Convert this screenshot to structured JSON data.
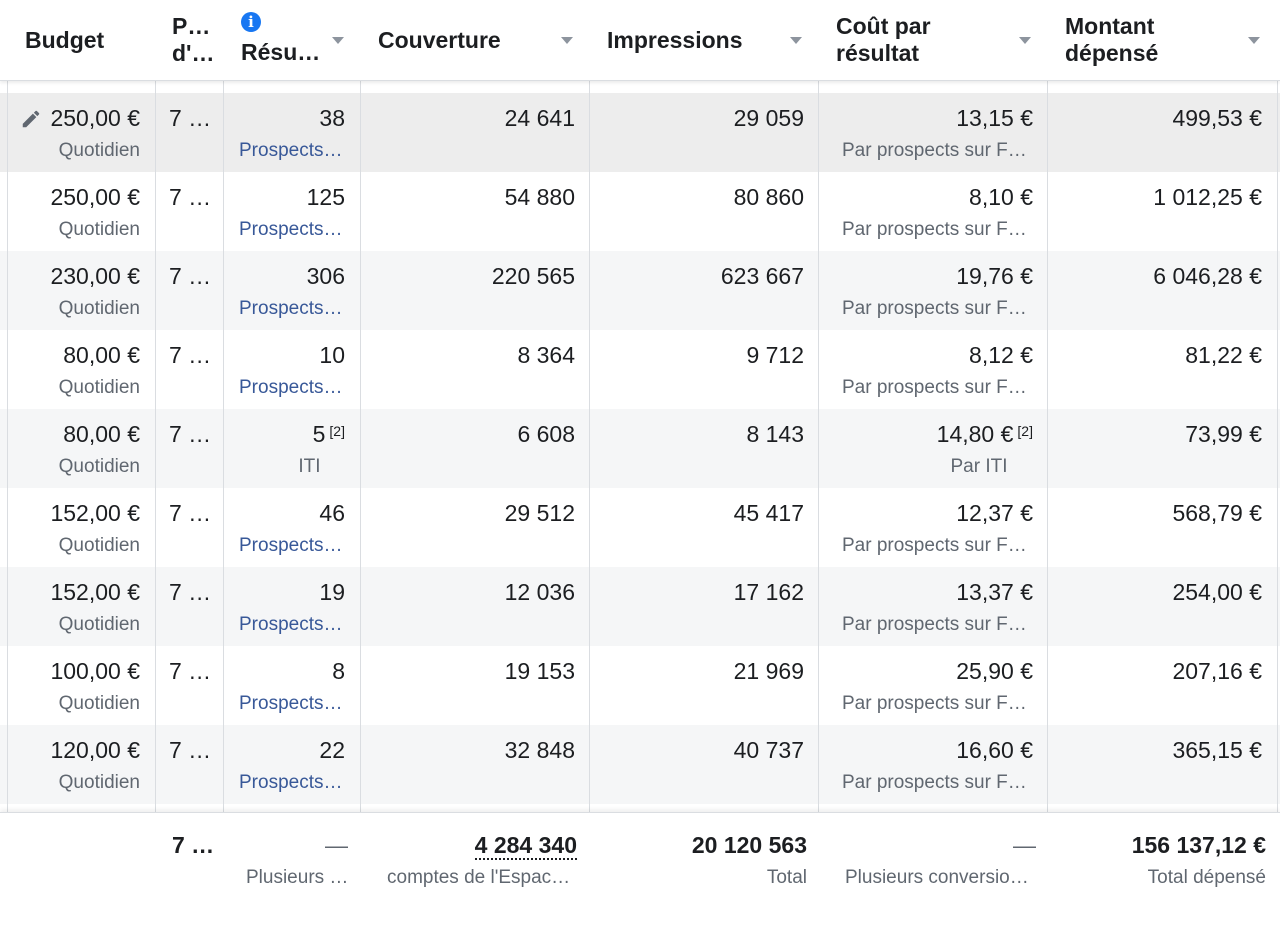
{
  "columns": {
    "budget": "Budget",
    "planning": "P… d'…",
    "results": "Résu…",
    "reach": "Couverture",
    "impressions": "Impressions",
    "cost_per_result": "Coût par résultat",
    "amount_spent": "Montant dépensé"
  },
  "rows": [
    {
      "budget": "250,00 €",
      "budget_type": "Quotidien",
      "planning": "7 …",
      "result": "38",
      "result_type": "Prospects…",
      "reach": "24 641",
      "impressions": "29 059",
      "cost": "13,15 €",
      "cost_type": "Par prospects sur F…",
      "spent": "499,53 €"
    },
    {
      "budget": "250,00 €",
      "budget_type": "Quotidien",
      "planning": "7 …",
      "result": "125",
      "result_type": "Prospects…",
      "reach": "54 880",
      "impressions": "80 860",
      "cost": "8,10 €",
      "cost_type": "Par prospects sur F…",
      "spent": "1 012,25 €"
    },
    {
      "budget": "230,00 €",
      "budget_type": "Quotidien",
      "planning": "7 …",
      "result": "306",
      "result_type": "Prospects…",
      "reach": "220 565",
      "impressions": "623 667",
      "cost": "19,76 €",
      "cost_type": "Par prospects sur F…",
      "spent": "6 046,28 €"
    },
    {
      "budget": "80,00 €",
      "budget_type": "Quotidien",
      "planning": "7 …",
      "result": "10",
      "result_type": "Prospects…",
      "reach": "8 364",
      "impressions": "9 712",
      "cost": "8,12 €",
      "cost_type": "Par prospects sur F…",
      "spent": "81,22 €"
    },
    {
      "budget": "80,00 €",
      "budget_type": "Quotidien",
      "planning": "7 …",
      "result": "5",
      "result_note": "[2]",
      "result_type": "ITI",
      "reach": "6 608",
      "impressions": "8 143",
      "cost": "14,80 €",
      "cost_note": "[2]",
      "cost_type": "Par ITI",
      "spent": "73,99 €"
    },
    {
      "budget": "152,00 €",
      "budget_type": "Quotidien",
      "planning": "7 …",
      "result": "46",
      "result_type": "Prospects…",
      "reach": "29 512",
      "impressions": "45 417",
      "cost": "12,37 €",
      "cost_type": "Par prospects sur F…",
      "spent": "568,79 €"
    },
    {
      "budget": "152,00 €",
      "budget_type": "Quotidien",
      "planning": "7 …",
      "result": "19",
      "result_type": "Prospects…",
      "reach": "12 036",
      "impressions": "17 162",
      "cost": "13,37 €",
      "cost_type": "Par prospects sur F…",
      "spent": "254,00 €"
    },
    {
      "budget": "100,00 €",
      "budget_type": "Quotidien",
      "planning": "7 …",
      "result": "8",
      "result_type": "Prospects…",
      "reach": "19 153",
      "impressions": "21 969",
      "cost": "25,90 €",
      "cost_type": "Par prospects sur F…",
      "spent": "207,16 €"
    },
    {
      "budget": "120,00 €",
      "budget_type": "Quotidien",
      "planning": "7 …",
      "result": "22",
      "result_type": "Prospects…",
      "reach": "32 848",
      "impressions": "40 737",
      "cost": "16,60 €",
      "cost_type": "Par prospects sur F…",
      "spent": "365,15 €"
    }
  ],
  "totals": {
    "planning": "7 …",
    "result": "—",
    "result_label": "Plusieurs …",
    "reach": "4 284 340",
    "reach_label": "comptes de l'Espac…",
    "impressions": "20 120 563",
    "impressions_label": "Total",
    "cost": "—",
    "cost_label": "Plusieurs conversio…",
    "spent": "156 137,12 €",
    "spent_label": "Total dépensé"
  },
  "colors": {
    "header_text": "#1c1e21",
    "secondary_text": "#606770",
    "link_text": "#385898",
    "info_icon": "#1877f2",
    "row_shade": "#f5f6f7",
    "row_selected": "#ededed",
    "grid_line": "#dadde1"
  },
  "icons": {
    "info": "info-icon",
    "edit": "pencil-icon",
    "sort": "sort-arrow-icon"
  }
}
